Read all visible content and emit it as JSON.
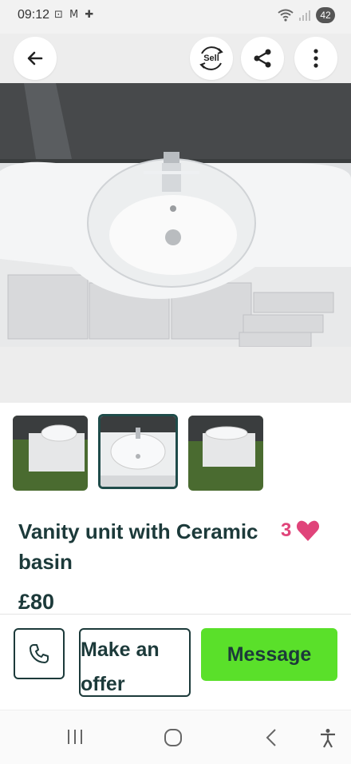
{
  "status": {
    "time": "09:12",
    "left_icons": "⊡ M ✚",
    "battery": "42"
  },
  "toolbar": {
    "back_icon": "arrow-left-icon",
    "sell_label": "Sell",
    "share_icon": "share-icon",
    "more_icon": "more-vertical-icon"
  },
  "listing": {
    "title": "Vanity unit with Ceramic basin",
    "likes": "3",
    "price": "£80",
    "thumbnails": [
      "thumb-1",
      "thumb-2",
      "thumb-3"
    ],
    "selected_thumbnail": 2
  },
  "actions": {
    "phone_icon": "phone-icon",
    "offer_label": "Make an offer",
    "message_label": "Message"
  },
  "colors": {
    "accent_green": "#5ae02a",
    "heart_pink": "#e0447a",
    "text_dark": "#1c3a3a"
  }
}
